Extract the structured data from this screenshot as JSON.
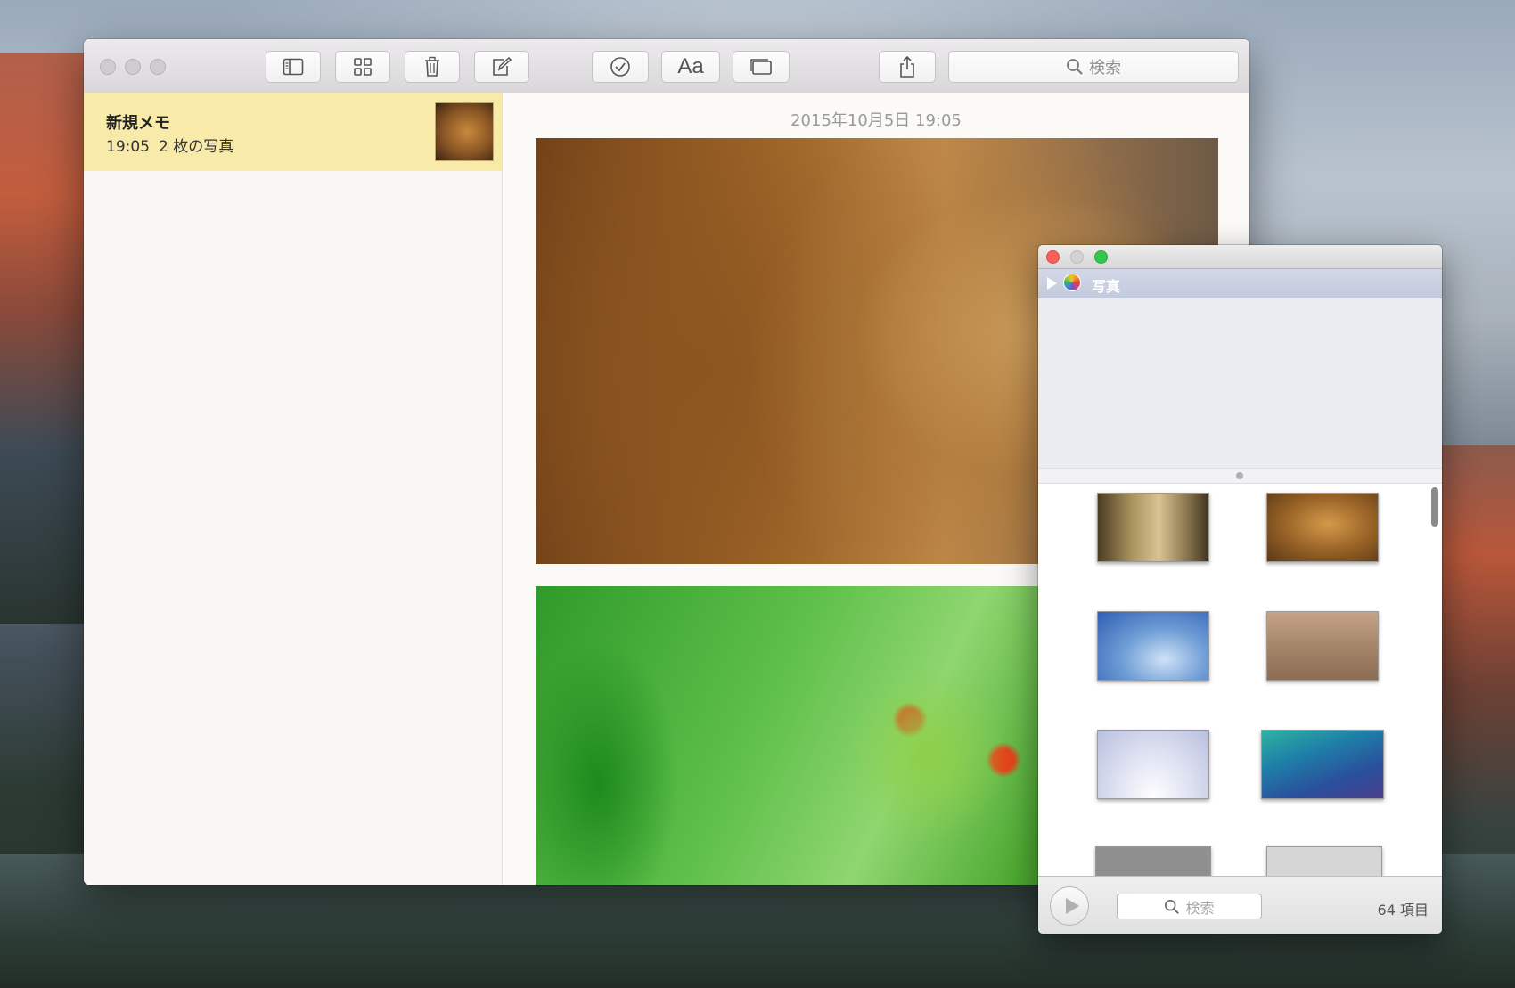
{
  "notes": {
    "toolbar": {
      "buttons": [
        "sidebar-toggle",
        "attachments",
        "delete",
        "compose",
        "checklist",
        "format",
        "table"
      ],
      "format_label": "Aa",
      "search_placeholder": "検索"
    },
    "note_list": [
      {
        "title": "新規メモ",
        "time": "19:05",
        "summary": "2 枚の写真"
      }
    ],
    "content": {
      "date": "2015年10月5日 19:05",
      "images": [
        "lion-photo",
        "frog-photo"
      ]
    }
  },
  "photo_browser": {
    "source_label": "写真",
    "search_placeholder": "検索",
    "item_count": "64 項目"
  },
  "colors": {
    "note_selected": "#f8eaa9",
    "close": "#fc5f57",
    "minimize": "#c8c8c8",
    "zoom": "#34c84a",
    "panel_header": "#c6cde0"
  }
}
